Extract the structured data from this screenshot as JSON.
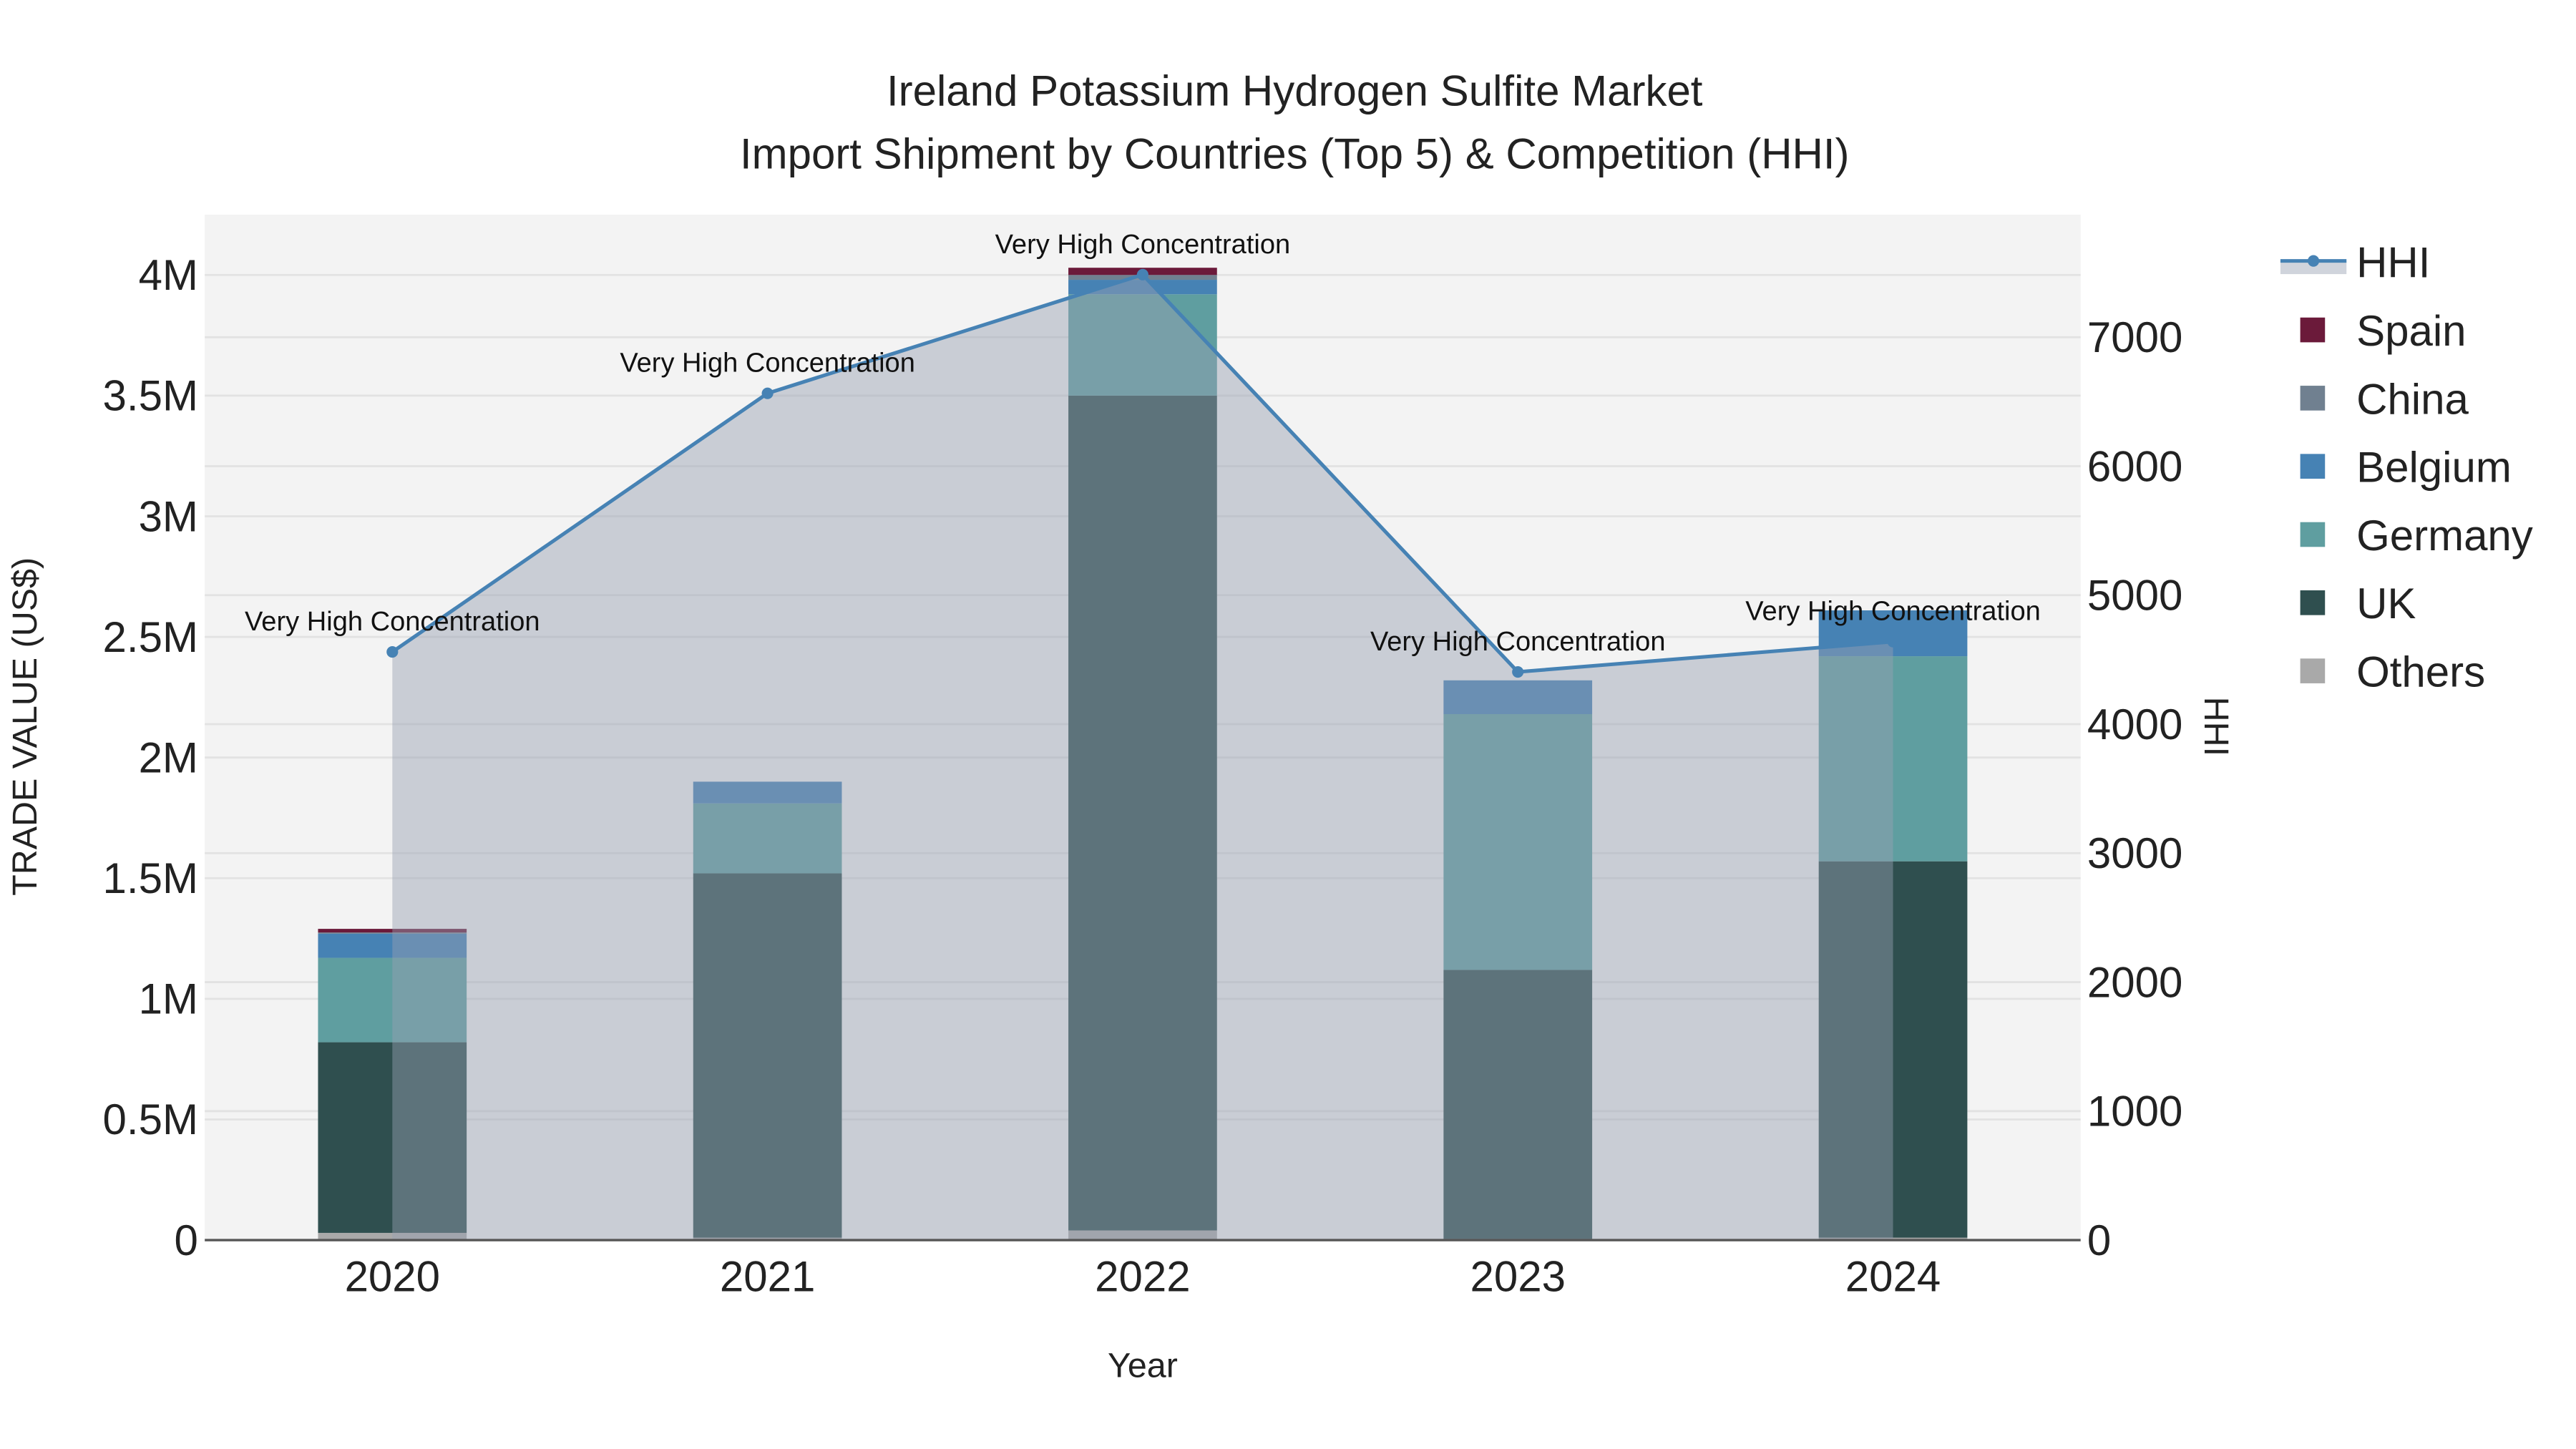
{
  "chart_data": {
    "type": "bar",
    "stacked": true,
    "title": "Ireland Potassium Hydrogen Sulfite Market",
    "subtitle": "Import Shipment by Countries (Top 5) & Competition (HHI)",
    "xlabel": "Year",
    "ylabel": "TRADE VALUE (US$)",
    "y2label": "HHI",
    "categories": [
      "2020",
      "2021",
      "2022",
      "2023",
      "2024"
    ],
    "ylim": [
      0,
      4250000
    ],
    "y2lim": [
      0,
      7950
    ],
    "yticks": [
      {
        "v": 0,
        "label": "0"
      },
      {
        "v": 500000,
        "label": "0.5M"
      },
      {
        "v": 1000000,
        "label": "1M"
      },
      {
        "v": 1500000,
        "label": "1.5M"
      },
      {
        "v": 2000000,
        "label": "2M"
      },
      {
        "v": 2500000,
        "label": "2.5M"
      },
      {
        "v": 3000000,
        "label": "3M"
      },
      {
        "v": 3500000,
        "label": "3.5M"
      },
      {
        "v": 4000000,
        "label": "4M"
      }
    ],
    "y2ticks": [
      {
        "v": 0,
        "label": "0"
      },
      {
        "v": 1000,
        "label": "1000"
      },
      {
        "v": 2000,
        "label": "2000"
      },
      {
        "v": 3000,
        "label": "3000"
      },
      {
        "v": 4000,
        "label": "4000"
      },
      {
        "v": 5000,
        "label": "5000"
      },
      {
        "v": 6000,
        "label": "6000"
      },
      {
        "v": 7000,
        "label": "7000"
      }
    ],
    "series": [
      {
        "name": "Others",
        "color": "#a9a9a9",
        "values": [
          30000,
          10000,
          40000,
          5000,
          10000
        ]
      },
      {
        "name": "UK",
        "color": "#2f4f4f",
        "values": [
          790000,
          1510000,
          3460000,
          1115000,
          1560000
        ]
      },
      {
        "name": "Germany",
        "color": "#5f9ea0",
        "values": [
          350000,
          290000,
          420000,
          1060000,
          850000
        ]
      },
      {
        "name": "Belgium",
        "color": "#4682b4",
        "values": [
          100000,
          90000,
          60000,
          140000,
          190000
        ]
      },
      {
        "name": "China",
        "color": "#708090",
        "values": [
          5000,
          0,
          20000,
          0,
          0
        ]
      },
      {
        "name": "Spain",
        "color": "#6b1a3a",
        "values": [
          15000,
          0,
          30000,
          0,
          0
        ]
      }
    ],
    "hhi": {
      "name": "HHI",
      "color": "#4682b4",
      "values": [
        4560,
        6565,
        7485,
        4405,
        4640
      ],
      "annotations": [
        "Very High Concentration",
        "Very High Concentration",
        "Very High Concentration",
        "Very High Concentration",
        "Very High Concentration"
      ]
    },
    "legend": {
      "placement": "right",
      "order": [
        "HHI",
        "Spain",
        "China",
        "Belgium",
        "Germany",
        "UK",
        "Others"
      ]
    }
  }
}
